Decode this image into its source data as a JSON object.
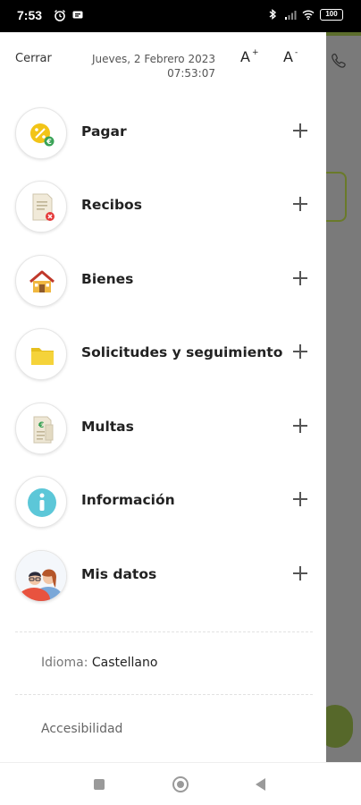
{
  "status_bar": {
    "time": "7:53",
    "battery": "100",
    "left_icons": [
      "alarm-icon",
      "message-icon"
    ],
    "right_icons": [
      "bluetooth-icon",
      "signal-icon",
      "wifi-icon",
      "battery-icon"
    ]
  },
  "drawer": {
    "close_label": "Cerrar",
    "date_line1": "Jueves, 2 Febrero 2023",
    "date_line2": "07:53:07",
    "font_increase": "A",
    "font_decrease": "A",
    "menu": [
      {
        "label": "Pagar",
        "icon": "coin-percent-icon"
      },
      {
        "label": "Recibos",
        "icon": "receipt-icon"
      },
      {
        "label": "Bienes",
        "icon": "house-icon"
      },
      {
        "label": "Solicitudes y seguimiento",
        "icon": "folder-icon"
      },
      {
        "label": "Multas",
        "icon": "fine-document-icon"
      },
      {
        "label": "Información",
        "icon": "info-icon"
      },
      {
        "label": "Mis datos",
        "icon": "people-icon"
      }
    ],
    "language_label": "Idioma:",
    "language_value": "Castellano",
    "accessibility_label": "Accesibilidad"
  },
  "colors": {
    "accent_green": "#5c6d2c",
    "coin_yellow": "#f2c417",
    "info_cyan": "#5cc7d8"
  },
  "nav_bar": {
    "icons": [
      "recents-square-icon",
      "home-circle-icon",
      "back-triangle-icon"
    ]
  }
}
